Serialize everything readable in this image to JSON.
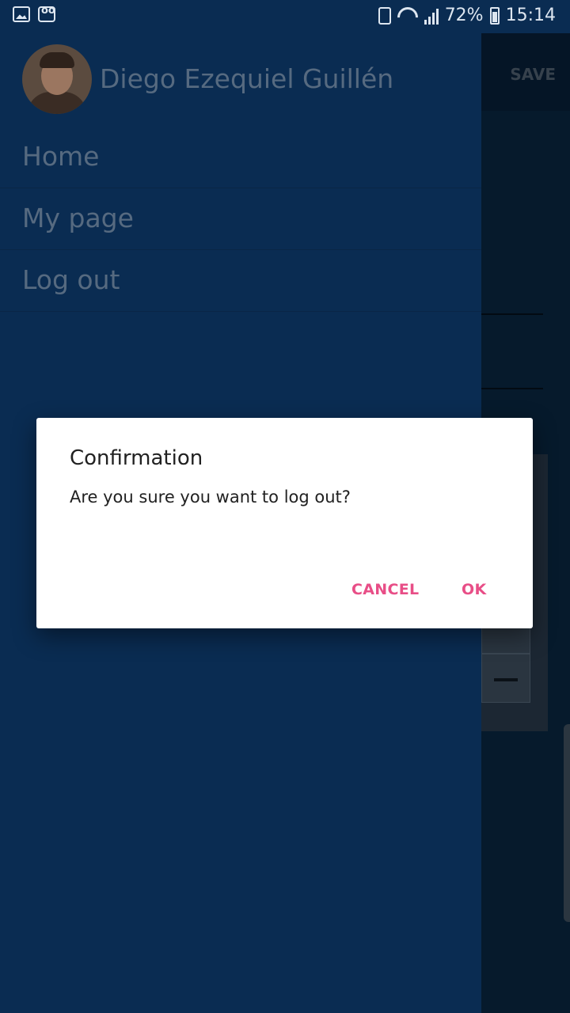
{
  "status_bar": {
    "battery_percent": "72%",
    "time": "15:14"
  },
  "app": {
    "toolbar_action": "SAVE"
  },
  "drawer": {
    "user_name": "Diego Ezequiel Guillén",
    "menu": [
      {
        "label": "Home"
      },
      {
        "label": "My page"
      },
      {
        "label": "Log out"
      }
    ]
  },
  "dialog": {
    "title": "Confirmation",
    "message": "Are you sure you want to log out?",
    "cancel_label": "CANCEL",
    "ok_label": "OK",
    "accent_color": "#e84e87"
  },
  "colors": {
    "drawer_bg": "#0a2c52",
    "scrim_bg": "#061a2c"
  }
}
